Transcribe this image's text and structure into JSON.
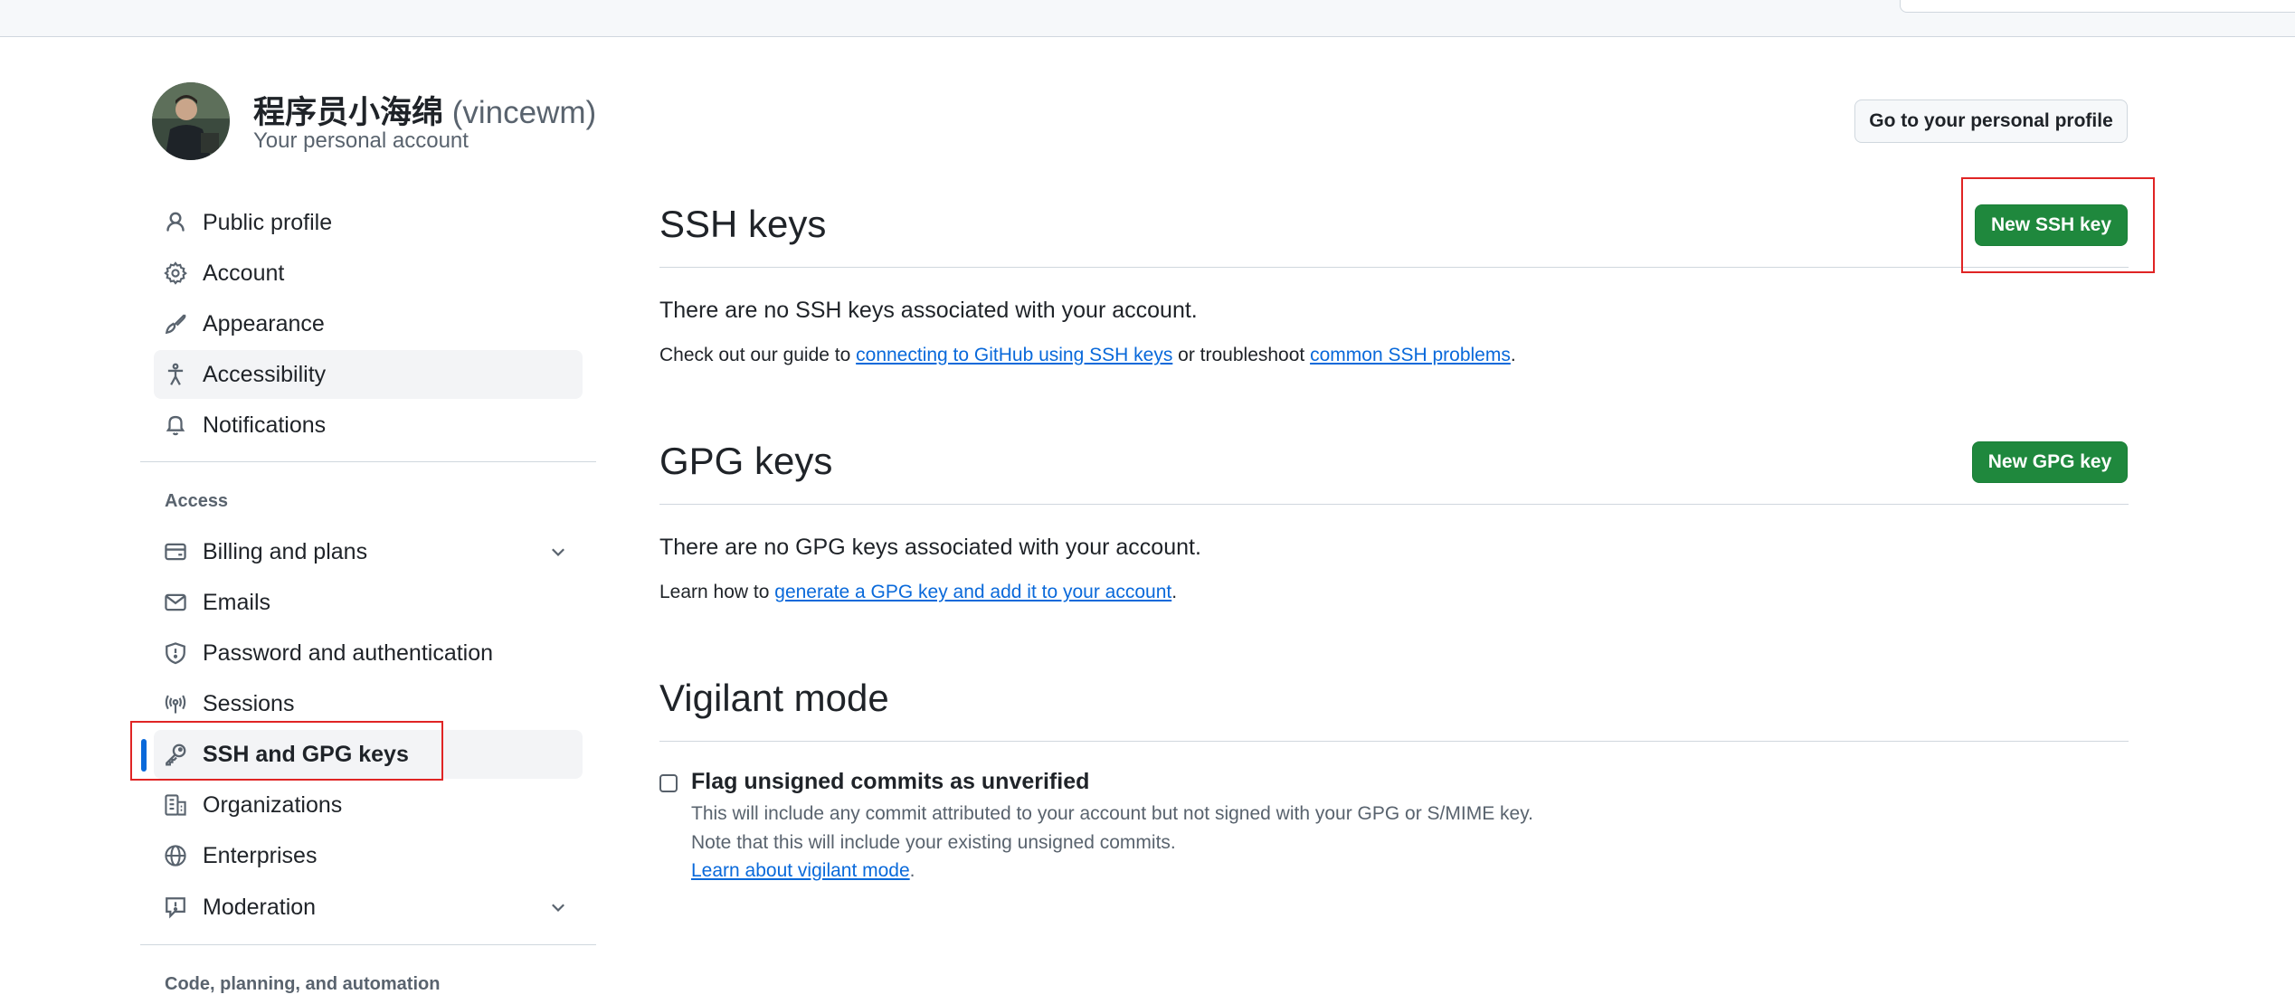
{
  "header": {
    "display_name": "程序员小海绵",
    "username": "(vincewm)",
    "subtitle": "Your personal account",
    "profile_button": "Go to your personal profile"
  },
  "sidebar": {
    "items_top": [
      {
        "label": "Public profile",
        "icon": "person-icon"
      },
      {
        "label": "Account",
        "icon": "gear-icon"
      },
      {
        "label": "Appearance",
        "icon": "paintbrush-icon"
      },
      {
        "label": "Accessibility",
        "icon": "accessibility-icon"
      },
      {
        "label": "Notifications",
        "icon": "bell-icon"
      }
    ],
    "access_heading": "Access",
    "items_access": [
      {
        "label": "Billing and plans",
        "icon": "credit-card-icon"
      },
      {
        "label": "Emails",
        "icon": "mail-icon"
      },
      {
        "label": "Password and authentication",
        "icon": "shield-icon"
      },
      {
        "label": "Sessions",
        "icon": "broadcast-icon"
      },
      {
        "label": "SSH and GPG keys",
        "icon": "key-icon"
      },
      {
        "label": "Organizations",
        "icon": "organization-icon"
      },
      {
        "label": "Enterprises",
        "icon": "globe-icon"
      },
      {
        "label": "Moderation",
        "icon": "report-icon"
      }
    ],
    "code_heading": "Code, planning, and automation"
  },
  "ssh": {
    "title": "SSH keys",
    "button": "New SSH key",
    "empty": "There are no SSH keys associated with your account.",
    "guide_prefix": "Check out our guide to ",
    "guide_link": "connecting to GitHub using SSH keys",
    "guide_middle": " or troubleshoot ",
    "problems_link": "common SSH problems",
    "guide_suffix": "."
  },
  "gpg": {
    "title": "GPG keys",
    "button": "New GPG key",
    "empty": "There are no GPG keys associated with your account.",
    "learn_prefix": "Learn how to ",
    "learn_link": "generate a GPG key and add it to your account",
    "learn_suffix": "."
  },
  "vigilant": {
    "title": "Vigilant mode",
    "checkbox_label": "Flag unsigned commits as unverified",
    "desc1": "This will include any commit attributed to your account but not signed with your GPG or S/MIME key.",
    "desc2": "Note that this will include your existing unsigned commits.",
    "learn_link": "Learn about vigilant mode",
    "learn_suffix": ".",
    "checked": false
  },
  "colors": {
    "accent": "#0969da",
    "primary_button": "#1f883d",
    "highlight": "#e02424"
  }
}
